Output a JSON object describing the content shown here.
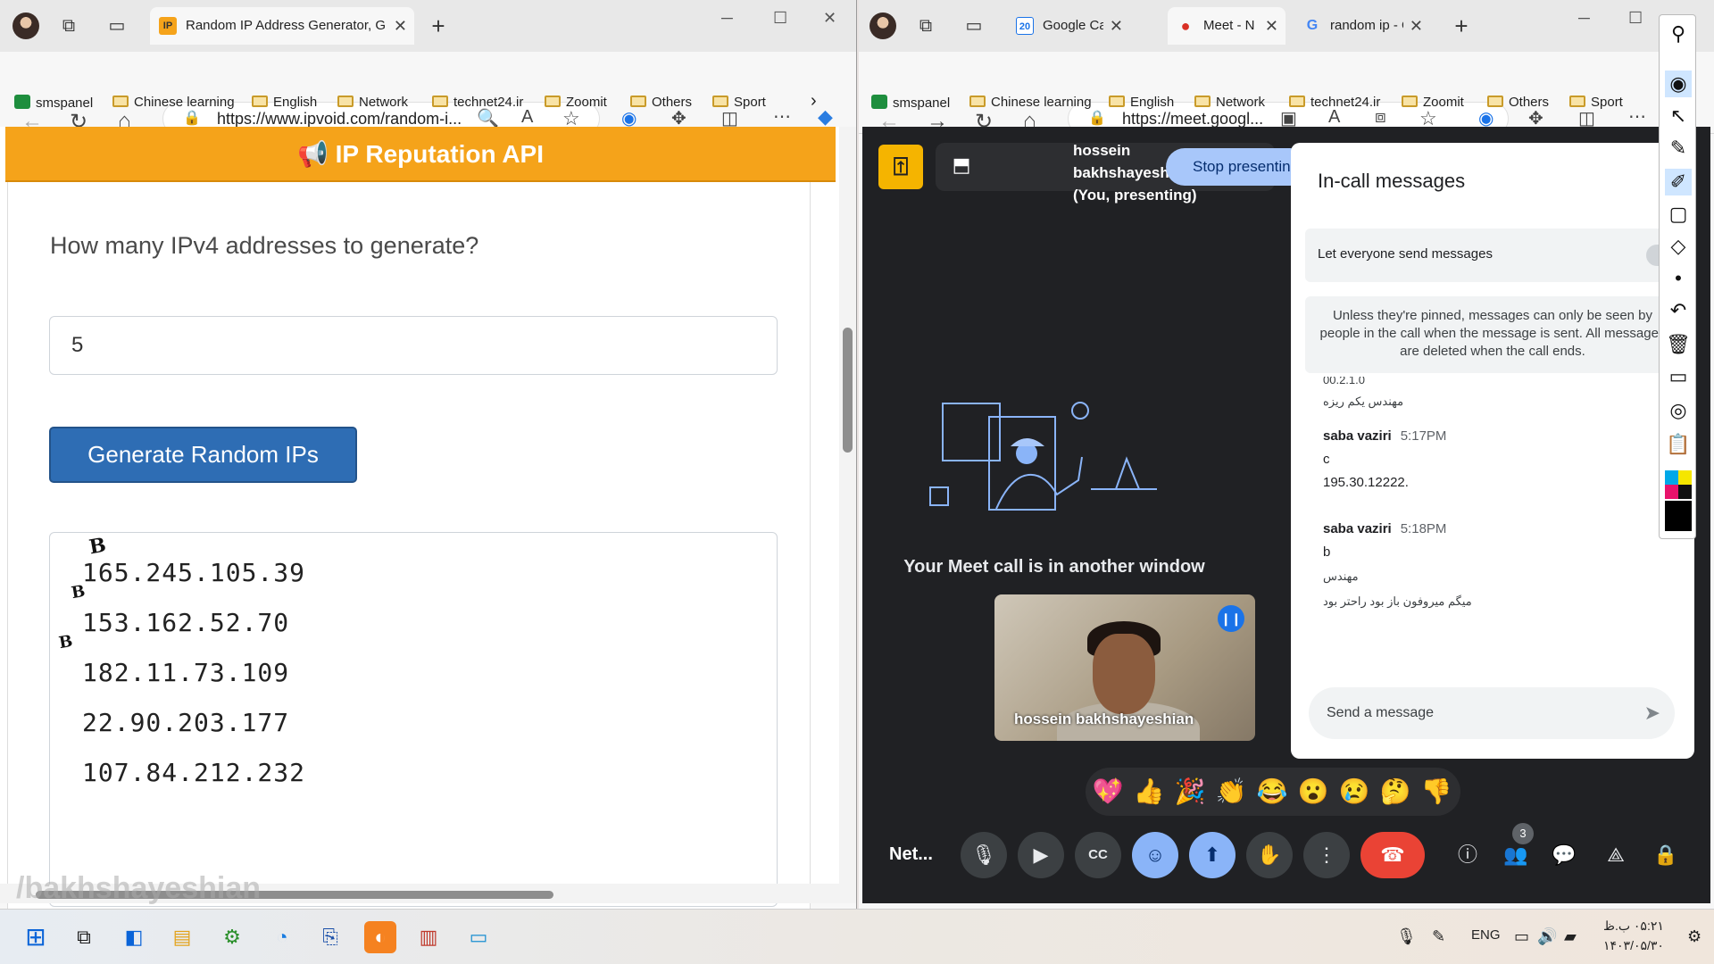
{
  "left_window": {
    "tab": {
      "title": "Random IP Address Generator, G",
      "favicon": "IP"
    },
    "url": "https://www.ipvoid.com/random-i...",
    "bookmarks": [
      "smspanel",
      "Chinese learning",
      "English",
      "Network",
      "technet24.ir",
      "Zoomit",
      "Others",
      "Sport"
    ],
    "banner": "IP Reputation API",
    "question": "How many IPv4 addresses to generate?",
    "count_value": "5",
    "generate_button": "Generate Random IPs",
    "ips": [
      "165.245.105.39",
      "153.162.52.70",
      "182.11.73.109",
      "22.90.203.177",
      "107.84.212.232"
    ],
    "annotations": [
      "B",
      "B",
      "B"
    ],
    "watermark": "/bakhshayeshian"
  },
  "right_window": {
    "tabs": [
      {
        "title": "Google Calen",
        "favicon": "20"
      },
      {
        "title": "Meet - N",
        "favicon": "●"
      },
      {
        "title": "random ip - G",
        "favicon": "G"
      }
    ],
    "url": "https://meet.googl...",
    "bookmarks": [
      "smspanel",
      "Chinese learning",
      "English",
      "Network",
      "technet24.ir",
      "Zoomit",
      "Others",
      "Sport"
    ],
    "meet": {
      "presenter_name": "hossein bakhshayeshian (You, presenting)",
      "stop_button": "Stop presenting",
      "another_window": "Your Meet call is in another window",
      "video_name": "hossein bakhshayeshian",
      "call_label": "Net...",
      "participants_count": "3",
      "emojis": [
        "💖",
        "👍",
        "🎉",
        "👏",
        "😂",
        "😮",
        "😢",
        "🤔",
        "👎"
      ]
    },
    "panel": {
      "title": "In-call messages",
      "toggle_label": "Let everyone send messages",
      "info": "Unless they're pinned, messages can only be seen by people in the call when the message is sent. All messages are deleted when the call ends.",
      "partial_top": "00.2.1.0",
      "m0_text": "مهندس یکم ریزه",
      "m1_sender": "saba vaziri",
      "m1_time": "5:17PM",
      "m1_l1": "c",
      "m1_l2": "195.30.12222.",
      "m2_sender": "saba vaziri",
      "m2_time": "5:18PM",
      "m2_l1": "b",
      "m2_l2": "مهندس",
      "m2_l3": "میگم میروفون باز بود راحتر بود",
      "input_placeholder": "Send a message"
    }
  },
  "taskbar": {
    "lang": "ENG",
    "time": "۰۵:۲۱ ب.ظ",
    "date": "۱۴۰۳/۰۵/۳۰"
  }
}
